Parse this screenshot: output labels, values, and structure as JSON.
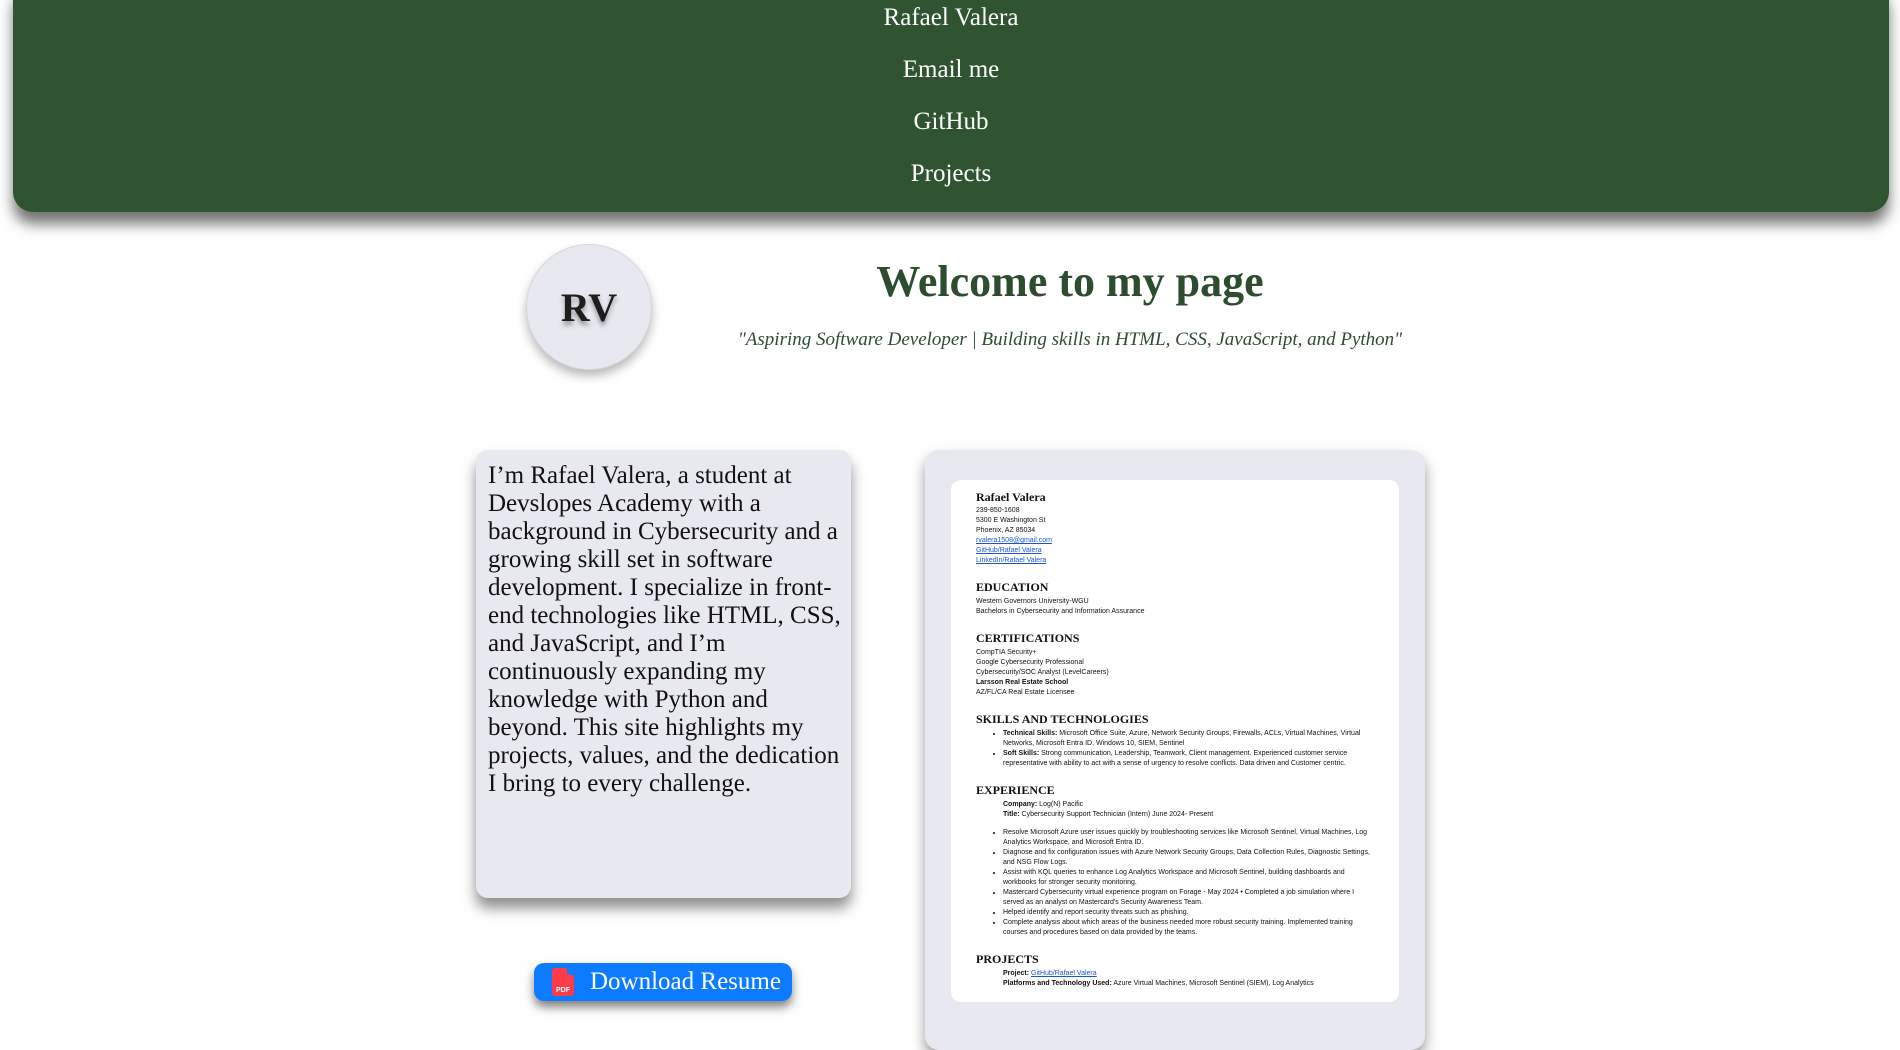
{
  "nav": {
    "links": [
      "Rafael Valera",
      "Email me",
      "GitHub",
      "Projects"
    ]
  },
  "header": {
    "avatar_initials": "RV",
    "title": "Welcome to my page",
    "tagline": "\"Aspiring Software Developer | Building skills in HTML, CSS, JavaScript, and Python\""
  },
  "bio": {
    "text": "I’m Rafael Valera, a student at Devslopes Academy with a background in Cybersecurity and a growing skill set in software development. I specialize in front-end technologies like HTML, CSS, and JavaScript, and I’m continuously expanding my knowledge with Python and beyond. This site highlights my projects, values, and the dedication I bring to every challenge."
  },
  "download": {
    "label": "Download Resume",
    "icon": "pdf-icon",
    "icon_text": "PDF"
  },
  "resume": {
    "name": "Rafael Valera",
    "phone": "239-850-1608",
    "address1": "5300 E Washington St",
    "address2": "Phoenix, AZ 85034",
    "email": "rvalera1508@gmail.com",
    "github": "GitHub/Rafael Valera",
    "linkedin": "LinkedIn/Rafael Valera",
    "education_heading": "EDUCATION",
    "education_school": "Western Governors University-WGU",
    "education_degree": "Bachelors in Cybersecurity and Information Assurance",
    "certs_heading": "CERTIFICATIONS",
    "cert1": "CompTIA Security+",
    "cert2": "Google Cybersecurity Professional",
    "cert3": "Cybersecurity/SOC Analyst (LevelCareers)",
    "cert4": "Larsson Real Estate School",
    "cert5": "AZ/FL/CA Real Estate Licensee",
    "skills_heading": "SKILLS AND TECHNOLOGIES",
    "skills_tech_label": "Technical Skills:",
    "skills_tech": " Microsoft Office Suite, Azure, Network Security Groups, Firewalls, ACLs, Virtual Machines, Virtual Networks, Microsoft Entra ID, Windows 10, SIEM, Sentinel",
    "skills_soft_label": "Soft Skills:",
    "skills_soft": " Strong communication, Leadership, Teamwork, Client management. Experienced customer service representative with ability to act with a sense of urgency to resolve conflicts. Data driven and Customer centric.",
    "experience_heading": "EXPERIENCE",
    "exp_company_label": "Company:",
    "exp_company": " Log(N) Pacific",
    "exp_title_label": "Title:",
    "exp_title": " Cybersecurity Support Technician (Intern) June 2024- Present",
    "exp_bullets": [
      "Resolve Microsoft Azure user issues quickly by troubleshooting services like Microsoft Sentinel, Virtual Machines, Log Analytics Workspace, and Microsoft Entra ID.",
      "Diagnose and fix configuration issues with Azure Network Security Groups, Data Collection Rules, Diagnostic Settings, and NSG Flow Logs.",
      "Assist with KQL queries to enhance Log Analytics Workspace and Microsoft Sentinel, building dashboards and workbooks for stronger security monitoring.",
      "Mastercard Cybersecurity virtual experience program on Forage - May 2024 • Completed a job simulation where I served as an analyst on Mastercard's Security Awareness Team.",
      "Helped identify and report security threats such as phishing.",
      "Complete analysis about which areas of the business needed more robust security training. Implemented training courses and procedures based on data provided by the teams."
    ],
    "projects_heading": "PROJECTS",
    "project_label": "Project:",
    "project_link": "GitHub/Rafael Valera",
    "platforms_label": "Platforms and Technology Used:",
    "platforms": " Azure Virtual Machines, Microsoft Sentinel (SIEM), Log Analytics"
  },
  "colors": {
    "nav_bg": "#305431",
    "heading_green": "#2e4c2f",
    "card_bg": "#e8e8f0",
    "button_blue": "#0d7bff",
    "pdf_red": "#ff3b4a"
  }
}
